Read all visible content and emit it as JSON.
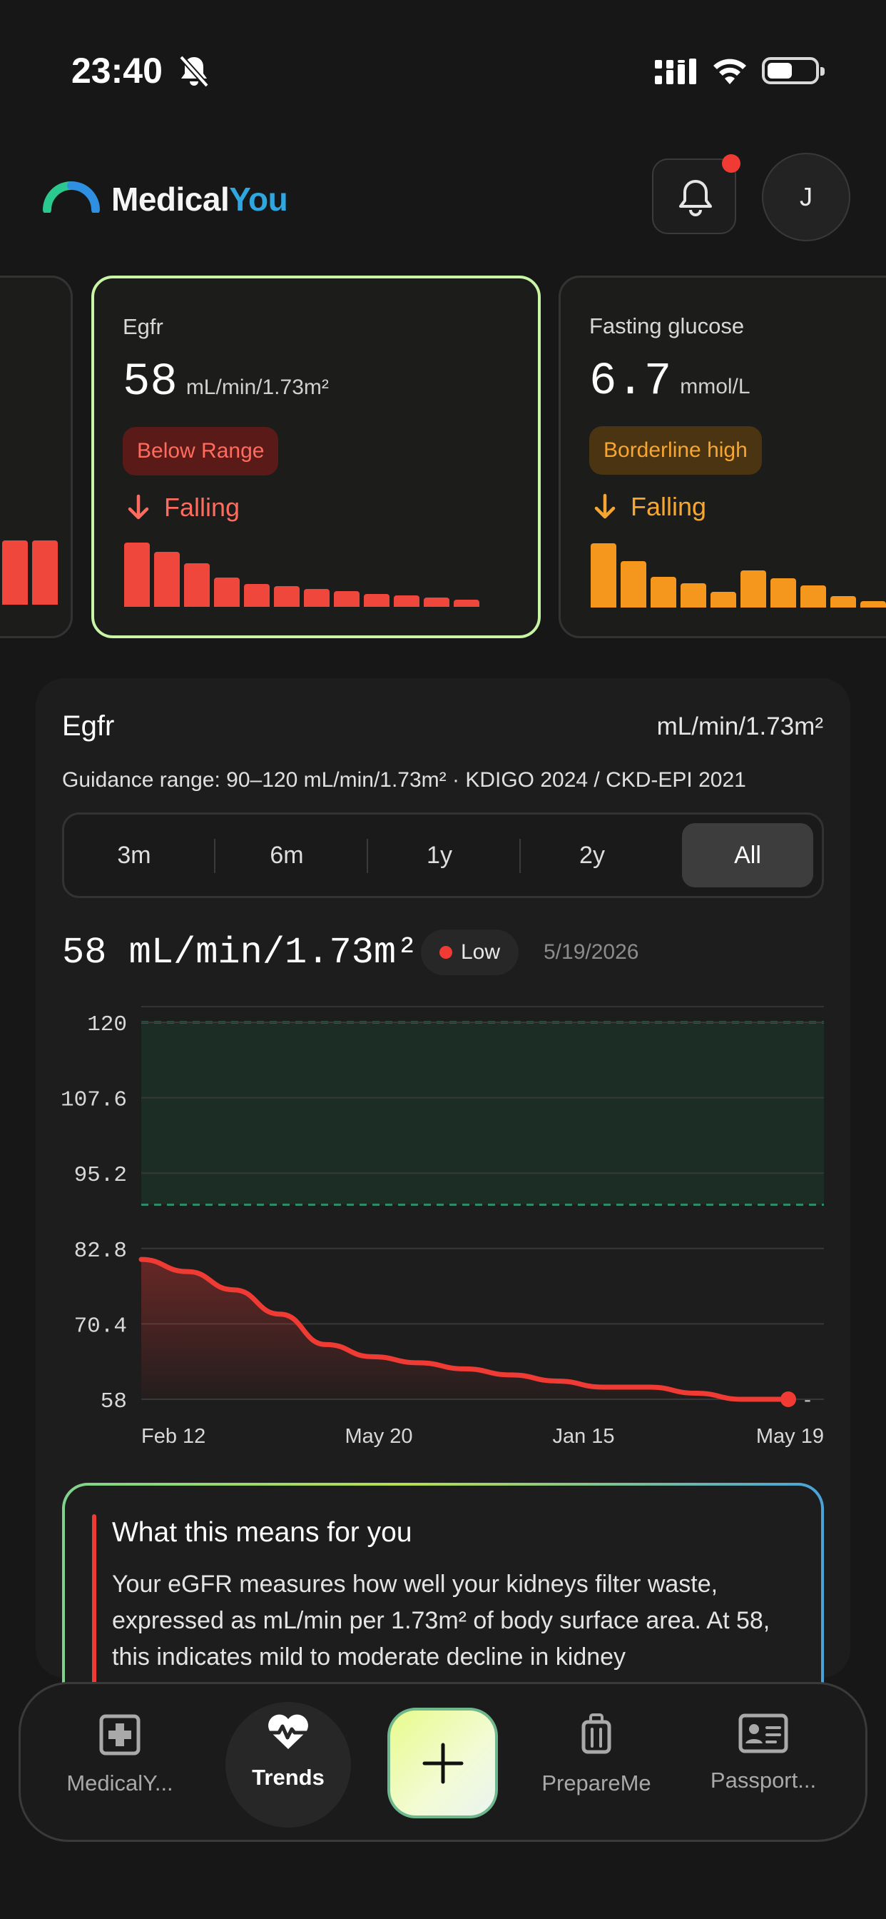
{
  "status": {
    "time": "23:40"
  },
  "header": {
    "logo_part1": "Medical",
    "logo_part2": "You",
    "avatar_initial": "J"
  },
  "cards": [
    {
      "name": "Egfr",
      "value": "58",
      "unit": "mL/min/1.73m²",
      "badge": "Below Range",
      "trend": "Falling",
      "bars": [
        100,
        86,
        68,
        46,
        36,
        32,
        28,
        24,
        20,
        18,
        14,
        11
      ],
      "color": "#f0473d"
    },
    {
      "name": "Fasting glucose",
      "value": "6.7",
      "unit": "mmol/L",
      "badge": "Borderline high",
      "trend": "Falling",
      "bars": [
        100,
        72,
        48,
        38,
        24,
        58,
        46,
        34,
        18,
        10
      ],
      "color": "#f5971c"
    }
  ],
  "detail": {
    "title": "Egfr",
    "unit": "mL/min/1.73m²",
    "guidance": "Guidance range: 90–120 mL/min/1.73m² · KDIGO 2024 / CKD-EPI 2021",
    "ranges": [
      "3m",
      "6m",
      "1y",
      "2y",
      "All"
    ],
    "selected_range": "All",
    "current_value": "58 mL/min/1.73m²",
    "status": "Low",
    "date": "5/19/2026"
  },
  "chart_data": {
    "type": "area",
    "y_ticks": [
      "120",
      "107.6",
      "95.2",
      "82.8",
      "70.4",
      "58"
    ],
    "ylim": [
      58,
      120
    ],
    "x_ticks": [
      "Feb 12",
      "May 20",
      "Jan 15",
      "May 19"
    ],
    "guidance_band": [
      90,
      120
    ],
    "values": [
      81,
      79,
      76,
      72,
      67,
      65,
      64,
      63,
      62,
      61,
      60,
      60,
      59,
      58,
      58
    ],
    "end_label": "-",
    "line_color": "#ef3b34",
    "band_color": "#1b2d25"
  },
  "info": {
    "title": "What this means for you",
    "text": "Your eGFR measures how well your kidneys filter waste, expressed as mL/min per 1.73m² of body surface area. At 58, this indicates mild to moderate decline in kidney"
  },
  "nav": {
    "items": [
      "MedicalY...",
      "Trends",
      "PrepareMe",
      "Passport..."
    ],
    "active": "Trends"
  }
}
